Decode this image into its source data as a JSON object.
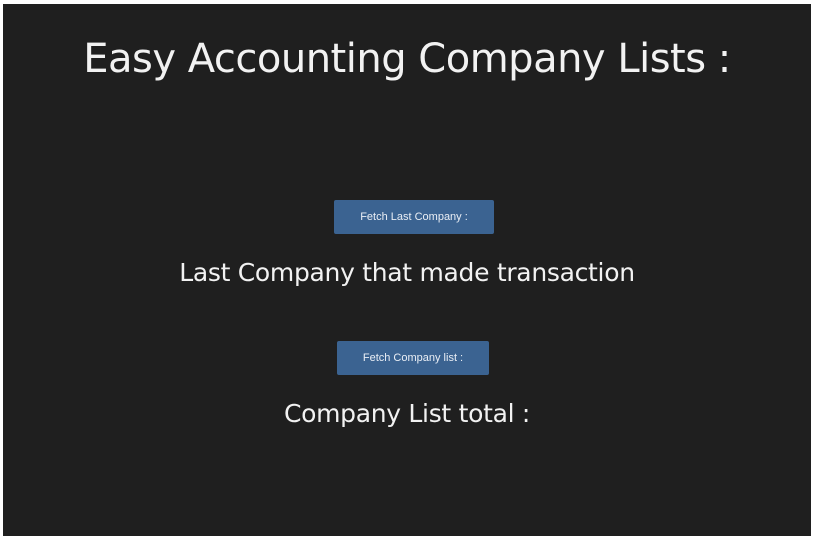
{
  "page": {
    "title": "Easy Accounting Company Lists :"
  },
  "last_company": {
    "button_label": "Fetch Last Company :",
    "caption": "Last Company that made transaction"
  },
  "company_list": {
    "button_label": "Fetch Company list :",
    "caption": "Company List total :"
  },
  "colors": {
    "background": "#1f1f1f",
    "button": "#3b6391",
    "text": "#f2f2f2"
  }
}
